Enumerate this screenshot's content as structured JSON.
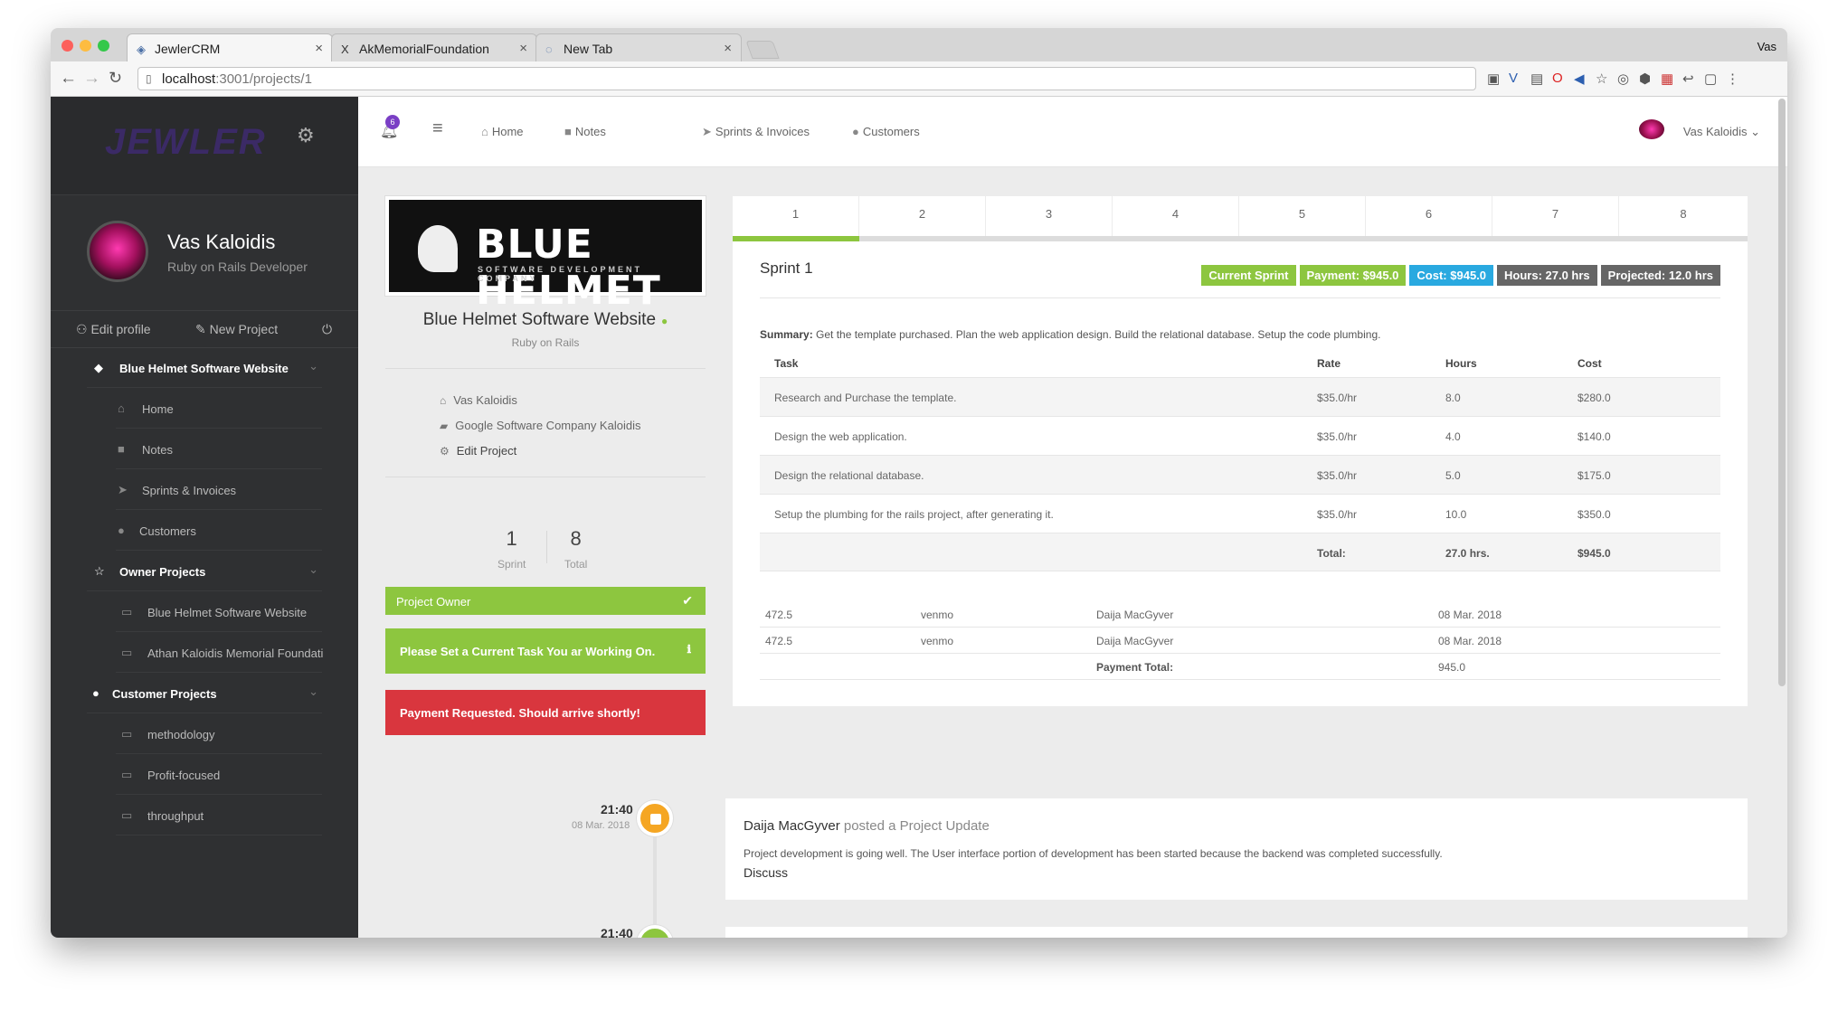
{
  "browser": {
    "tabs": [
      {
        "title": "JewlerCRM",
        "active": true
      },
      {
        "title": "AkMemorialFoundation",
        "active": false
      },
      {
        "title": "New Tab",
        "active": false
      }
    ],
    "profile": "Vas",
    "url_host": "localhost",
    "url_path": ":3001/projects/1"
  },
  "sidebar": {
    "logo": "JEWLER",
    "user": {
      "name": "Vas Kaloidis",
      "role": "Ruby on Rails Developer"
    },
    "actions": {
      "edit_profile": "Edit profile",
      "new_project": "New Project"
    },
    "project": "Blue Helmet Software Website",
    "project_items": [
      "Home",
      "Notes",
      "Sprints & Invoices",
      "Customers"
    ],
    "owner_projects_label": "Owner Projects",
    "owner_projects": [
      "Blue Helmet Software Website",
      "Athan Kaloidis Memorial Foundati"
    ],
    "customer_projects_label": "Customer Projects",
    "customer_projects": [
      "methodology",
      "Profit-focused",
      "throughput"
    ]
  },
  "topnav": {
    "notifications": "6",
    "links": [
      "Home",
      "Notes",
      "Sprints & Invoices",
      "Customers"
    ],
    "user": "Vas Kaloidis"
  },
  "project": {
    "logo_title": "BLUE HELMET",
    "logo_sub": "SOFTWARE DEVELOPMENT COMPANY",
    "title": "Blue Helmet Software Website",
    "subtitle": "Ruby on Rails",
    "links": [
      "Vas Kaloidis",
      "Google Software Company Kaloidis",
      "Edit Project"
    ],
    "stats": [
      {
        "n": "1",
        "l": "Sprint"
      },
      {
        "n": "8",
        "l": "Total"
      }
    ],
    "owner_label": "Project Owner",
    "task_notice": "Please Set a Current Task You ar Working On.",
    "payment_notice": "Payment Requested. Should arrive shortly!"
  },
  "sprints": {
    "tabs": [
      "1",
      "2",
      "3",
      "4",
      "5",
      "6",
      "7",
      "8"
    ],
    "active_index": 0,
    "title": "Sprint 1",
    "badges": [
      {
        "text": "Current Sprint",
        "color": "#8dc63f"
      },
      {
        "text": "Payment: $945.0",
        "color": "#8dc63f"
      },
      {
        "text": "Cost: $945.0",
        "color": "#29a9e0"
      },
      {
        "text": "Hours: 27.0 hrs",
        "color": "#666666"
      },
      {
        "text": "Projected: 12.0 hrs",
        "color": "#666666"
      }
    ],
    "summary_label": "Summary:",
    "summary": "Get the template purchased. Plan the web application design. Build the relational database. Setup the code plumbing.",
    "columns": [
      "Task",
      "Rate",
      "Hours",
      "Cost"
    ],
    "rows": [
      [
        "Research and Purchase the template.",
        "$35.0/hr",
        "8.0",
        "$280.0"
      ],
      [
        "Design the web application.",
        "$35.0/hr",
        "4.0",
        "$140.0"
      ],
      [
        "Design the relational database.",
        "$35.0/hr",
        "5.0",
        "$175.0"
      ],
      [
        "Setup the plumbing for the rails project, after generating it.",
        "$35.0/hr",
        "10.0",
        "$350.0"
      ]
    ],
    "total": {
      "label": "Total:",
      "hours": "27.0 hrs.",
      "cost": "$945.0"
    },
    "payments": [
      [
        "472.5",
        "venmo",
        "Daija MacGyver",
        "08 Mar. 2018"
      ],
      [
        "472.5",
        "venmo",
        "Daija MacGyver",
        "08 Mar. 2018"
      ]
    ],
    "payment_total": {
      "label": "Payment Total:",
      "value": "945.0"
    }
  },
  "timeline": [
    {
      "time": "21:40",
      "date": "08 Mar. 2018",
      "color": "#f5a623",
      "author": "Daija MacGyver",
      "action": "posted a Project Update",
      "body": "Project development is going well. The User interface portion of development has been started because the backend was completed successfully.",
      "link": "Discuss"
    },
    {
      "time": "21:40",
      "color": "#8dc63f"
    }
  ]
}
